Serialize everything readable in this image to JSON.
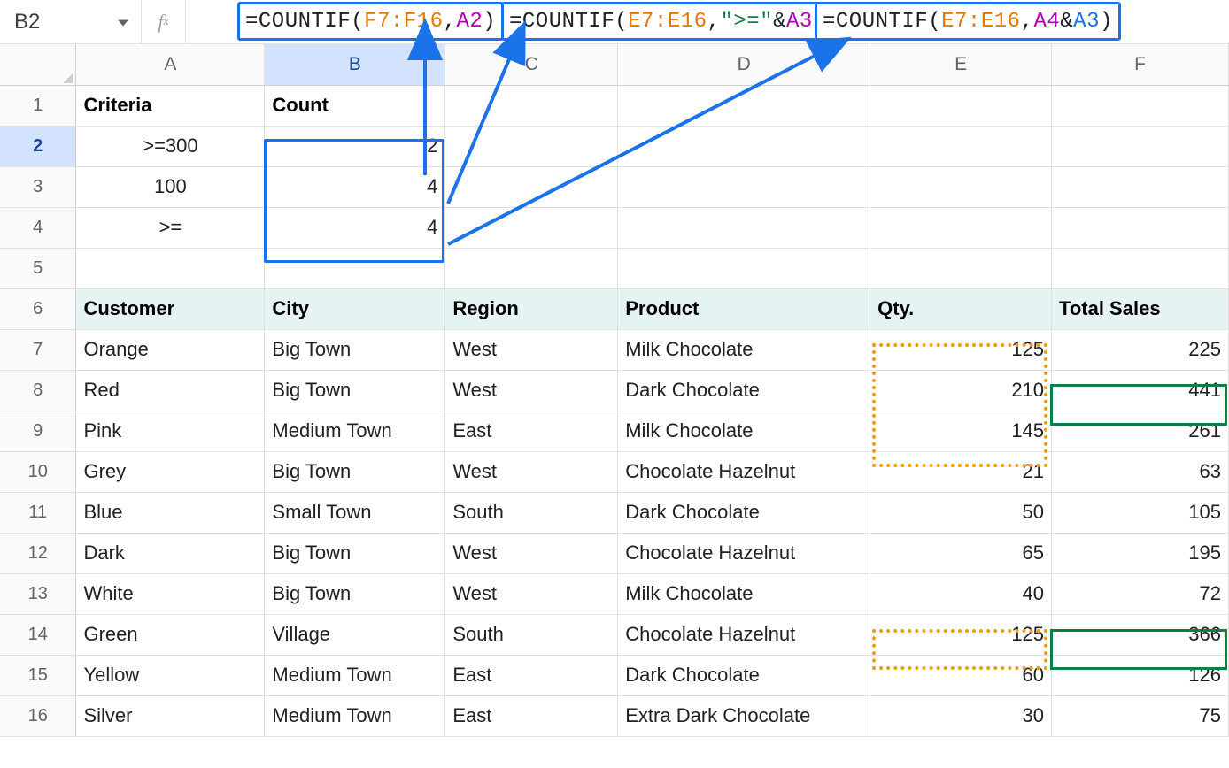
{
  "nameBox": "B2",
  "fxLabel": "fx",
  "formulas": {
    "f1": {
      "prefix": "=COUNTIF(",
      "range": "F7:F16",
      "sep": ",",
      "arg_a": "A2",
      "suffix": ")"
    },
    "f2": {
      "prefix": "=COUNTIF(",
      "range": "E7:E16",
      "sep": ",",
      "lit": "\">=\"",
      "amp": "&",
      "arg_a": "A3",
      "suffix": ")"
    },
    "f3": {
      "prefix": "=COUNTIF(",
      "range": "E7:E16",
      "sep": ",",
      "arg_b": "A4",
      "amp": "&",
      "arg_a": "A3",
      "suffix": ")"
    }
  },
  "colHeaders": {
    "A": "A",
    "B": "B",
    "C": "C",
    "D": "D",
    "E": "E",
    "F": "F"
  },
  "rows": {
    "1": {
      "A": "Criteria",
      "B": "Count"
    },
    "2": {
      "A": ">=300",
      "B": "2"
    },
    "3": {
      "A": "100",
      "B": "4"
    },
    "4": {
      "A": ">=",
      "B": "4"
    },
    "6": {
      "A": "Customer",
      "B": "City",
      "C": "Region",
      "D": "Product",
      "E": "Qty.",
      "F": "Total Sales"
    },
    "7": {
      "A": "Orange",
      "B": "Big Town",
      "C": "West",
      "D": "Milk Chocolate",
      "E": "125",
      "F": "225"
    },
    "8": {
      "A": "Red",
      "B": "Big Town",
      "C": "West",
      "D": "Dark Chocolate",
      "E": "210",
      "F": "441"
    },
    "9": {
      "A": "Pink",
      "B": "Medium Town",
      "C": "East",
      "D": "Milk Chocolate",
      "E": "145",
      "F": "261"
    },
    "10": {
      "A": "Grey",
      "B": "Big Town",
      "C": "West",
      "D": "Chocolate Hazelnut",
      "E": "21",
      "F": "63"
    },
    "11": {
      "A": "Blue",
      "B": "Small Town",
      "C": "South",
      "D": "Dark Chocolate",
      "E": "50",
      "F": "105"
    },
    "12": {
      "A": "Dark",
      "B": "Big Town",
      "C": "West",
      "D": "Chocolate Hazelnut",
      "E": "65",
      "F": "195"
    },
    "13": {
      "A": "White",
      "B": "Big Town",
      "C": "West",
      "D": "Milk Chocolate",
      "E": "40",
      "F": "72"
    },
    "14": {
      "A": "Green",
      "B": "Village",
      "C": "South",
      "D": "Chocolate Hazelnut",
      "E": "125",
      "F": "366"
    },
    "15": {
      "A": "Yellow",
      "B": "Medium Town",
      "C": "East",
      "D": "Dark Chocolate",
      "E": "60",
      "F": "126"
    },
    "16": {
      "A": "Silver",
      "B": "Medium Town",
      "C": "East",
      "D": "Extra Dark Chocolate",
      "E": "30",
      "F": "75"
    }
  }
}
